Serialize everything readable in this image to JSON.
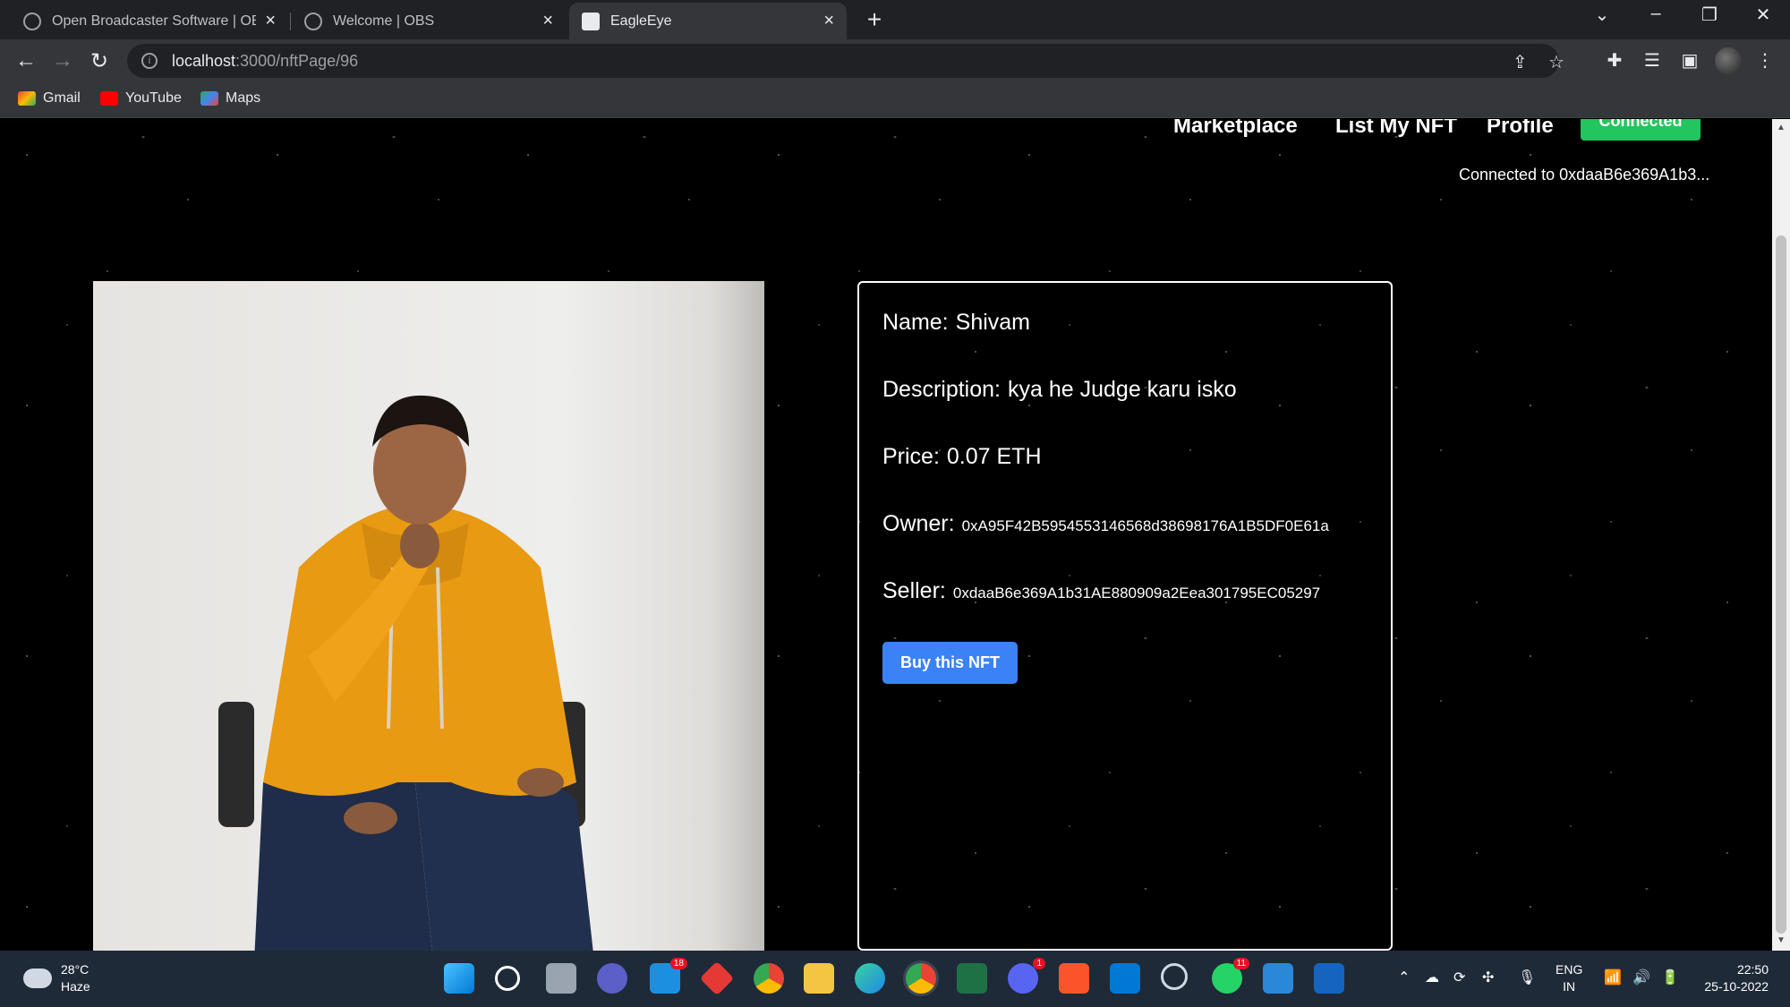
{
  "browser": {
    "tabs": [
      {
        "title": "Open Broadcaster Software | OBS",
        "active": false
      },
      {
        "title": "Welcome | OBS",
        "active": false
      },
      {
        "title": "EagleEye",
        "active": true
      }
    ],
    "url_host": "localhost",
    "url_path": ":3000/nftPage/96",
    "bookmarks": [
      "Gmail",
      "YouTube",
      "Maps"
    ],
    "icons": [
      "back-icon",
      "forward-icon",
      "reload-icon",
      "info-icon",
      "share-icon",
      "star-icon",
      "extensions-icon",
      "reading-list-icon",
      "side-panel-icon",
      "menu-icon"
    ]
  },
  "navbar": {
    "links": [
      "Marketplace",
      "List My NFT",
      "Profile"
    ],
    "connect_label": "Connected",
    "connected_text": "Connected to 0xdaaB6e369A1b3..."
  },
  "nft": {
    "name_label": "Name:",
    "name": "Shivam",
    "description_label": "Description:",
    "description": "kya he Judge karu isko",
    "price_label": "Price:",
    "price": "0.07 ETH",
    "owner_label": "Owner:",
    "owner": "0xA95F42B5954553146568d38698176A1B5DF0E61a",
    "seller_label": "Seller:",
    "seller": "0xdaaB6e369A1b31AE880909a2Eea301795EC05297",
    "buy_label": "Buy this NFT"
  },
  "taskbar": {
    "temperature": "28°C",
    "weather": "Haze",
    "mail_badge": "18",
    "discord_badge": "1",
    "whatsapp_badge": "11",
    "lang_top": "ENG",
    "lang_bottom": "IN",
    "time": "22:50",
    "date": "25-10-2022"
  },
  "colors": {
    "accent_blue": "#3b82f6",
    "connected_green": "#22c55e",
    "page_bg": "#000000"
  }
}
